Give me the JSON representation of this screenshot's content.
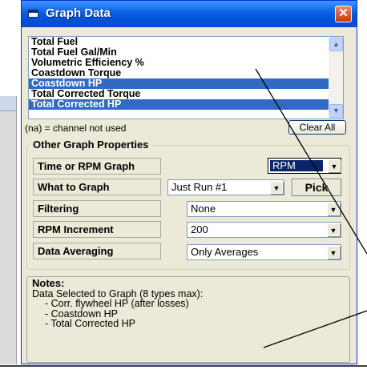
{
  "window": {
    "title": "Graph Data",
    "close_glyph": "✕"
  },
  "channels": [
    {
      "label": "Total Fuel",
      "selected": false
    },
    {
      "label": "Total Fuel Gal/Min",
      "selected": false
    },
    {
      "label": "Volumetric Efficiency %",
      "selected": false
    },
    {
      "label": "Coastdown Torque",
      "selected": false
    },
    {
      "label": "Coastdown HP",
      "selected": true
    },
    {
      "label": "Total Corrected Torque",
      "selected": false
    },
    {
      "label": "Total Corrected HP",
      "selected": true
    }
  ],
  "hint_text": "(na) = channel not used",
  "clear_all_label": "Clear All",
  "other_props": {
    "title": "Other Graph Properties",
    "time_or_rpm": {
      "label": "Time or RPM Graph",
      "value": "RPM"
    },
    "what_to_graph": {
      "label": "What to Graph",
      "value": "Just Run #1",
      "pick_label": "Pick"
    },
    "filtering": {
      "label": "Filtering",
      "value": "None"
    },
    "rpm_increment": {
      "label": "RPM Increment",
      "value": "200"
    },
    "data_averaging": {
      "label": "Data Averaging",
      "value": "Only Averages"
    }
  },
  "notes": {
    "title": "Notes:",
    "intro": "Data Selected to Graph (8 types max):",
    "items": [
      "- Corr. flywheel HP (after losses)",
      "- Coastdown HP",
      "- Total Corrected HP"
    ]
  },
  "colors": {
    "title_bar": "#0a5fe0",
    "selection": "#316ac5",
    "dialog_bg": "#ece9d8",
    "close_button": "#c9380c"
  }
}
